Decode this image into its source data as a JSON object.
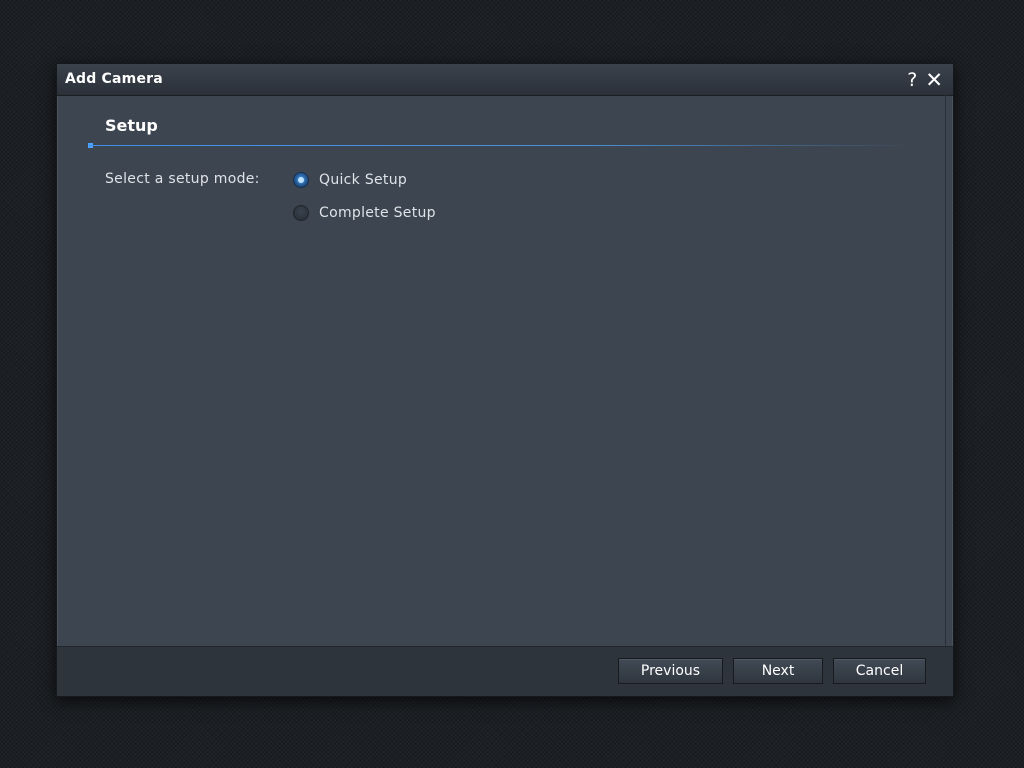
{
  "dialog": {
    "title": "Add Camera",
    "help_icon": "question-mark-icon",
    "help_glyph": "?",
    "close_icon": "close-icon",
    "close_glyph": "✕"
  },
  "section": {
    "title": "Setup"
  },
  "setup_mode": {
    "label": "Select a setup mode:",
    "options": [
      {
        "label": "Quick Setup",
        "selected": true
      },
      {
        "label": "Complete Setup",
        "selected": false
      }
    ]
  },
  "footer": {
    "previous_label": "Previous",
    "next_label": "Next",
    "cancel_label": "Cancel"
  },
  "colors": {
    "accent": "#4da3ff",
    "dialog_bg": "#3c4550",
    "footer_bg": "#2e343c"
  }
}
